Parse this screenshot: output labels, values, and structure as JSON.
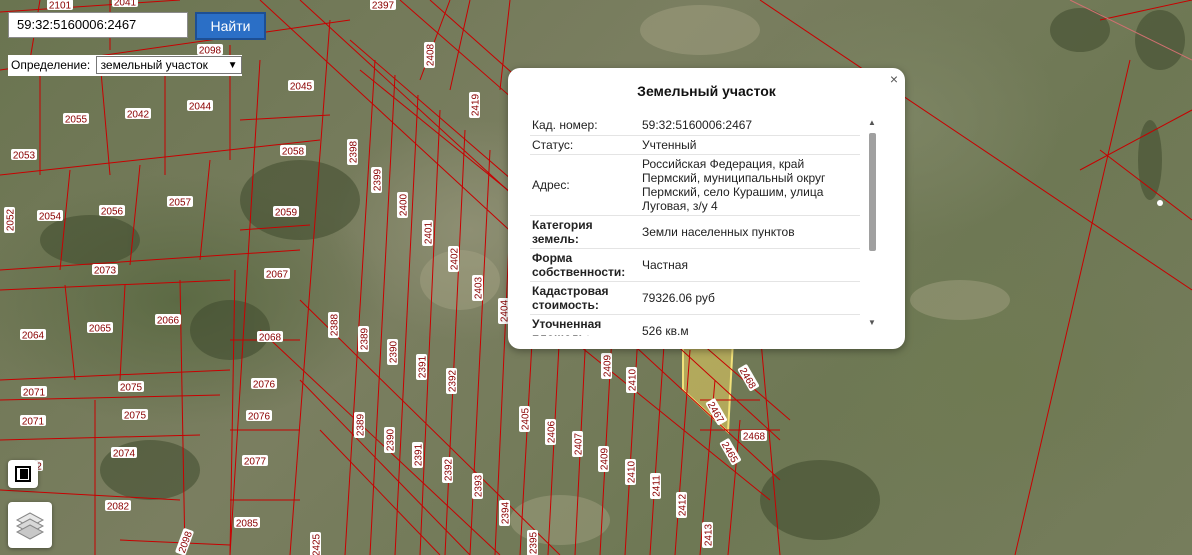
{
  "search": {
    "value": "59:32:5160006:2467",
    "button_label": "Найти"
  },
  "definition": {
    "label": "Определение:",
    "selected": "земельный участок"
  },
  "tools": {
    "fullscreen_icon": "fullscreen-icon",
    "layers_icon": "layers-icon"
  },
  "colors": {
    "parcel_line": "#c80000",
    "label_text": "#8a0000",
    "selected_fill": "#e8d060",
    "button": "#2b6fc6"
  },
  "map_labels": [
    {
      "t": "2101"
    },
    {
      "t": "2041"
    },
    {
      "t": "2397"
    },
    {
      "t": "2098"
    },
    {
      "t": "2408"
    },
    {
      "t": "2045"
    },
    {
      "t": "2419"
    },
    {
      "t": "2055"
    },
    {
      "t": "2042"
    },
    {
      "t": "2044"
    },
    {
      "t": "2053"
    },
    {
      "t": "2058"
    },
    {
      "t": "2398"
    },
    {
      "t": "2399"
    },
    {
      "t": "2052"
    },
    {
      "t": "2054"
    },
    {
      "t": "2056"
    },
    {
      "t": "2057"
    },
    {
      "t": "2059"
    },
    {
      "t": "2400"
    },
    {
      "t": "2401"
    },
    {
      "t": "2402"
    },
    {
      "t": "2403"
    },
    {
      "t": "2073"
    },
    {
      "t": "2067"
    },
    {
      "t": "2404"
    },
    {
      "t": "2064"
    },
    {
      "t": "2065"
    },
    {
      "t": "2066"
    },
    {
      "t": "2068"
    },
    {
      "t": "2388"
    },
    {
      "t": "2389"
    },
    {
      "t": "2390"
    },
    {
      "t": "2391"
    },
    {
      "t": "2392"
    },
    {
      "t": "2071"
    },
    {
      "t": "2075"
    },
    {
      "t": "2076"
    },
    {
      "t": "2409"
    },
    {
      "t": "2410"
    },
    {
      "t": "2468"
    },
    {
      "t": "2071"
    },
    {
      "t": "2075"
    },
    {
      "t": "2076"
    },
    {
      "t": "2405"
    },
    {
      "t": "2406"
    },
    {
      "t": "2467"
    },
    {
      "t": "2389"
    },
    {
      "t": "2390"
    },
    {
      "t": "2391"
    },
    {
      "t": "2407"
    },
    {
      "t": "2468"
    },
    {
      "t": "2074"
    },
    {
      "t": "2077"
    },
    {
      "t": "2392"
    },
    {
      "t": "2409"
    },
    {
      "t": "2465"
    },
    {
      "t": "2410"
    },
    {
      "t": "2393"
    },
    {
      "t": "2411"
    },
    {
      "t": "2082"
    },
    {
      "t": "2394"
    },
    {
      "t": "2412"
    },
    {
      "t": "2085"
    },
    {
      "t": "2098"
    },
    {
      "t": "2425"
    },
    {
      "t": "2395"
    },
    {
      "t": "2413"
    },
    {
      "t": "2"
    }
  ],
  "popup": {
    "title": "Земельный участок",
    "close": "×",
    "rows": [
      {
        "key": "Кад. номер:",
        "value": "59:32:5160006:2467"
      },
      {
        "key": "Статус:",
        "value": "Учтенный"
      },
      {
        "key": "Адрес:",
        "value": "Российская Федерация, край Пермский, муниципальный округ Пермский, село Курашим, улица Луговая, з/у 4"
      },
      {
        "key": "Категория земель:",
        "value": "Земли населенных пунктов"
      },
      {
        "key": "Форма собственности:",
        "value": "Частная"
      },
      {
        "key": "Кадастровая стоимость:",
        "value": "79326.06 руб"
      },
      {
        "key": "Уточненная площадь:",
        "value": "526 кв.м"
      }
    ]
  }
}
